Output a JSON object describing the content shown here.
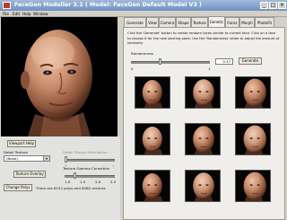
{
  "window": {
    "title": "FaceGen Modeller 3.1 ( Model: FaceGen Default Model V3 )"
  },
  "menu": [
    "File",
    "Edit",
    "Help",
    "Window"
  ],
  "viewport": {
    "help_label": "Viewport Help"
  },
  "left": {
    "detail_texture_label": "Detail Texture",
    "detail_texture_value": "(None)",
    "detail_blend_label": "Detail Texture Modulation",
    "detail_blend_ticks": [
      "0",
      "1"
    ],
    "texture_overlay_label": "Texture Overlay",
    "gamma_label": "Texture Gamma Correction",
    "gamma_ticks": [
      "1.0",
      "1.5",
      "2.0",
      "2.5"
    ],
    "change_polys_label": "Change Polys",
    "polys_info": "There are 6152 polys and 6260 vertices"
  },
  "tabs": [
    "Generate",
    "View",
    "Camera",
    "Shape",
    "Texture",
    "Genetic",
    "Faces",
    "Morph",
    "PhotoFit"
  ],
  "active_tab": "Genetic",
  "genetic": {
    "description": "Click the 'Generate' button to create random faces similar to current face. Click on a face to choose it for the new starting point. Use the 'Randomness' slider to adjust the amount of similarity.",
    "randomness_label": "Randomness",
    "randomness_value": "0.37",
    "randomness_ticks": [
      "0",
      "1"
    ],
    "randomness_level": 0.37,
    "generate_label": "Generate",
    "faces_count": 9
  },
  "colors": {
    "titlebar": "#6f93c4",
    "panel": "#d4d0c8",
    "tab_content": "#efeeea"
  }
}
